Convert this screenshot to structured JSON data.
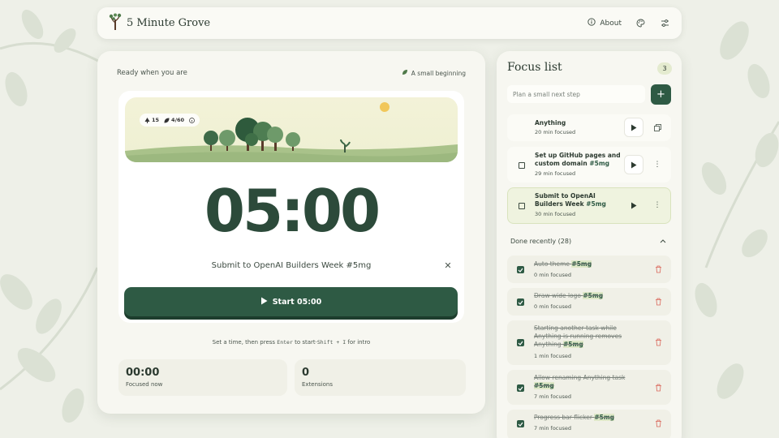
{
  "header": {
    "title": "5 Minute Grove",
    "about_label": "About",
    "icons": [
      "sapling-logo-icon",
      "info-icon",
      "palette-icon",
      "sliders-icon"
    ]
  },
  "timer": {
    "status": "Ready when you are",
    "stage": "A small beginning",
    "trees_count": "15",
    "progress": "4/60",
    "display": "05:00",
    "task": "Submit to OpenAI Builders Week #5mg",
    "start_label": "Start 05:00",
    "hint_pre": "Set a time, then press ",
    "hint_key1": "Enter",
    "hint_mid": " to start·",
    "hint_key2": "Shift + I",
    "hint_post": " for intro"
  },
  "stats": {
    "focused_value": "00:00",
    "focused_label": "Focused now",
    "extensions_value": "0",
    "extensions_label": "Extensions"
  },
  "focus_list": {
    "title": "Focus list",
    "count": "3",
    "input_placeholder": "Plan a small next step",
    "add_label": "+",
    "tasks": [
      {
        "name": "Anything",
        "tag": "",
        "meta": "20 min focused"
      },
      {
        "name": "Set up GitHub pages and custom domain",
        "tag": "#5mg",
        "meta": "29 min focused"
      },
      {
        "name": "Submit to OpenAI Builders Week",
        "tag": "#5mg",
        "meta": "30 min focused"
      }
    ],
    "done_header": "Done recently (28)",
    "done": [
      {
        "name": "Auto theme",
        "tag": "#5mg",
        "meta": "0 min focused"
      },
      {
        "name": "Draw wide logo",
        "tag": "#5mg",
        "meta": "0 min focused"
      },
      {
        "name": "Starting another task while Anything is running removes Anything",
        "tag": "#5mg",
        "meta": "1 min focused"
      },
      {
        "name": "Allow renaming Anything task",
        "tag": "#5mg",
        "meta": "7 min focused"
      },
      {
        "name": "Progress bar flicker",
        "tag": "#5mg",
        "meta": "7 min focused"
      }
    ]
  },
  "colors": {
    "accent": "#2e5a44",
    "background": "#eef0e8",
    "card": "#f7f7f1",
    "delete": "#d9665a"
  }
}
